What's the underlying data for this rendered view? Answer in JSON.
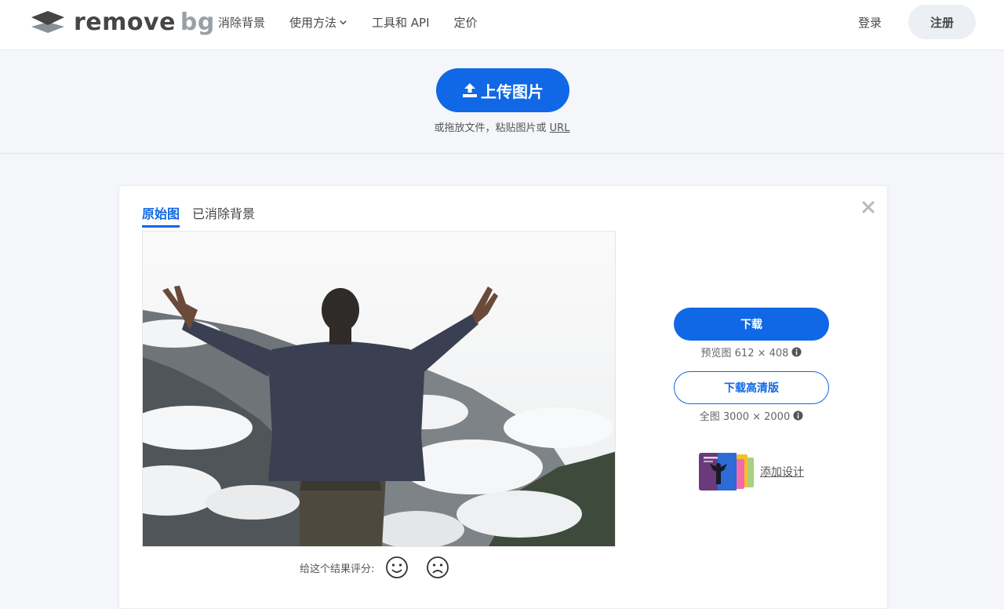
{
  "header": {
    "logo": {
      "word1": "remove",
      "word2": "bg"
    },
    "nav": [
      {
        "label": "消除背景"
      },
      {
        "label": "使用方法"
      },
      {
        "label": "工具和 API"
      },
      {
        "label": "定价"
      }
    ],
    "login": "登录",
    "signup": "注册"
  },
  "upload": {
    "button": "上传图片",
    "hint": "或拖放文件，粘贴图片或",
    "url": "URL"
  },
  "editor": {
    "tabs": [
      "原始图",
      "已消除背景"
    ],
    "active_tab": "原始图",
    "download": "下载",
    "preview_info": "预览图 612 × 408",
    "download_hd": "下载高清版",
    "full_info": "全图 3000 × 2000",
    "add_design": "添加设计",
    "rating_label": "给这个结果评分:"
  },
  "colors": {
    "accent": "#1068e6",
    "text": "#454545",
    "background": "#f4f6f9"
  },
  "icons": [
    "logo-stack-icon",
    "chevron-down-icon",
    "upload-icon",
    "close-icon",
    "info-icon",
    "smile-icon",
    "frown-icon"
  ]
}
